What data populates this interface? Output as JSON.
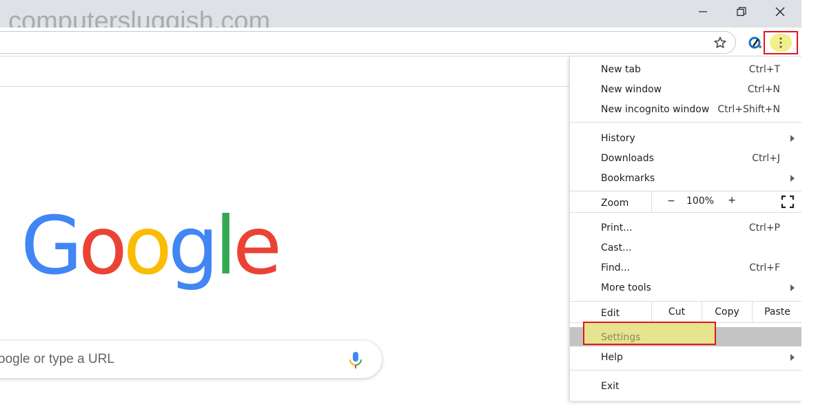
{
  "watermark": "computersluggish.com",
  "window_controls": {
    "minimize": "minimize",
    "maximize": "maximize",
    "close": "close"
  },
  "toolbar": {
    "bookmark_icon": "star-icon",
    "extension_icon": "extension-icon",
    "menu_icon": "three-dot-menu-icon"
  },
  "page": {
    "logo_letters": [
      {
        "ch": "G",
        "color": "#4285F4"
      },
      {
        "ch": "o",
        "color": "#EA4335"
      },
      {
        "ch": "o",
        "color": "#FBBC05"
      },
      {
        "ch": "g",
        "color": "#4285F4"
      },
      {
        "ch": "l",
        "color": "#34A853"
      },
      {
        "ch": "e",
        "color": "#EA4335"
      }
    ],
    "search_placeholder": "oogle or type a URL"
  },
  "menu": {
    "new_tab": {
      "label": "New tab",
      "shortcut": "Ctrl+T"
    },
    "new_window": {
      "label": "New window",
      "shortcut": "Ctrl+N"
    },
    "new_incognito": {
      "label": "New incognito window",
      "shortcut": "Ctrl+Shift+N"
    },
    "history": {
      "label": "History"
    },
    "downloads": {
      "label": "Downloads",
      "shortcut": "Ctrl+J"
    },
    "bookmarks": {
      "label": "Bookmarks"
    },
    "zoom": {
      "label": "Zoom",
      "minus": "−",
      "value": "100%",
      "plus": "+"
    },
    "print": {
      "label": "Print...",
      "shortcut": "Ctrl+P"
    },
    "cast": {
      "label": "Cast..."
    },
    "find": {
      "label": "Find...",
      "shortcut": "Ctrl+F"
    },
    "more_tools": {
      "label": "More tools"
    },
    "edit": {
      "label": "Edit",
      "cut": "Cut",
      "copy": "Copy",
      "paste": "Paste"
    },
    "settings": {
      "label": "Settings"
    },
    "help": {
      "label": "Help"
    },
    "exit": {
      "label": "Exit"
    }
  },
  "colors": {
    "highlight_border": "#e2141b",
    "highlight_fill": "#e7e48f",
    "titlebar": "#dee1e6"
  }
}
